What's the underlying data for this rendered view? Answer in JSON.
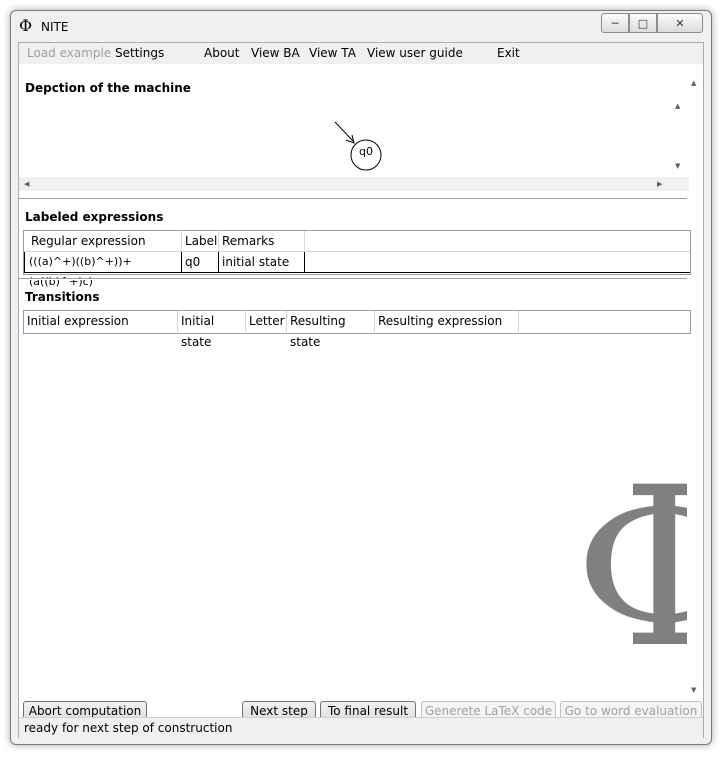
{
  "window": {
    "title": "NITE",
    "title_icon": "Φ"
  },
  "menu": {
    "items": [
      {
        "label": "Load example",
        "disabled": true
      },
      {
        "label": "Settings"
      },
      {
        "label": "About"
      },
      {
        "label": "View BA"
      },
      {
        "label": "View TA"
      },
      {
        "label": "View user guide"
      },
      {
        "label": "Exit"
      }
    ]
  },
  "depiction": {
    "title": "Depction of the machine",
    "state_label": "q0"
  },
  "labeled": {
    "title": "Labeled expressions",
    "columns": [
      "Regular expression",
      "Label",
      "Remarks"
    ],
    "rows": [
      {
        "expr": "(((a)^+)((b)^+))+(a((b)^+)c)",
        "label": "q0",
        "remarks": "initial state"
      }
    ]
  },
  "transitions": {
    "title": "Transitions",
    "columns": [
      "Initial expression",
      "Initial state",
      "Letter",
      "Resulting state",
      "Resulting expression"
    ]
  },
  "buttons": {
    "abort": "Abort computation",
    "next": "Next step",
    "final": "To final result",
    "latex": "Generete LaTeX code",
    "word": "Go to word evaluation"
  },
  "status": {
    "text": "ready for next step of construction"
  },
  "logo": {
    "glyph": "Φ",
    "color": "#808080"
  }
}
